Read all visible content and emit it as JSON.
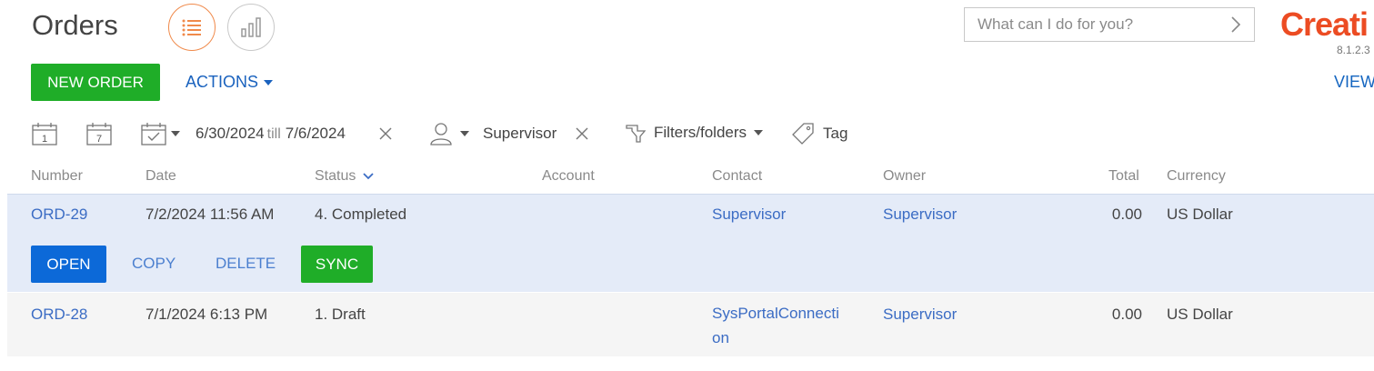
{
  "header": {
    "title": "Orders",
    "search_placeholder": "What can I do for you?",
    "logo_text": "Creati",
    "version": "8.1.2.3",
    "view_link": "VIEW"
  },
  "toolbar": {
    "new_order_label": "NEW ORDER",
    "actions_label": "ACTIONS"
  },
  "filters": {
    "day_icon_number": "1",
    "week_icon_number": "7",
    "date_from": "6/30/2024",
    "date_till_label": "till",
    "date_to": "7/6/2024",
    "owner_filter": "Supervisor",
    "filters_folders_label": "Filters/folders",
    "tag_label": "Tag"
  },
  "table": {
    "columns": [
      "Number",
      "Date",
      "Status",
      "Account",
      "Contact",
      "Owner",
      "Total",
      "Currency"
    ],
    "rows": [
      {
        "number": "ORD-29",
        "date": "7/2/2024 11:56 AM",
        "status": "4. Completed",
        "account": "",
        "contact": "Supervisor",
        "owner": "Supervisor",
        "total": "0.00",
        "currency": "US Dollar"
      },
      {
        "number": "ORD-28",
        "date": "7/1/2024 6:13 PM",
        "status": "1. Draft",
        "account": "",
        "contact_line1": "SysPortalConnecti",
        "contact_line2": "on",
        "owner": "Supervisor",
        "total": "0.00",
        "currency": "US Dollar"
      }
    ],
    "row_actions": {
      "open": "OPEN",
      "copy": "COPY",
      "delete": "DELETE",
      "sync": "SYNC"
    }
  },
  "colors": {
    "accent_orange": "#f08a4b",
    "primary_green": "#1fad28",
    "primary_blue": "#0c69d8",
    "link_blue": "#3b6cc4",
    "logo_red": "#ec4c23",
    "selected_row": "#e4ebf8"
  }
}
